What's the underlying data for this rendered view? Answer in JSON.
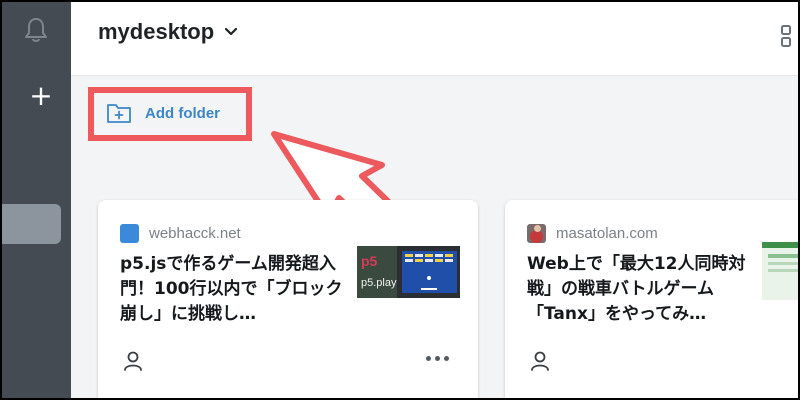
{
  "header": {
    "desktop_name": "mydesktop"
  },
  "toolbar": {
    "add_folder_label": "Add folder"
  },
  "colors": {
    "sidebar": "#444b53",
    "highlight": "#ec5a5e",
    "link": "#3d87c9"
  },
  "cards": [
    {
      "source": "webhacck.net",
      "title": "p5.jsで作るゲーム開発超入門！100行以内で「ブロック崩し」に挑戦し…",
      "thumbnail_text": "p5.play"
    },
    {
      "source": "masatolan.com",
      "title": "Web上で「最大12人同時対戦」の戦車バトルゲーム「Tanx」をやってみ…"
    }
  ]
}
